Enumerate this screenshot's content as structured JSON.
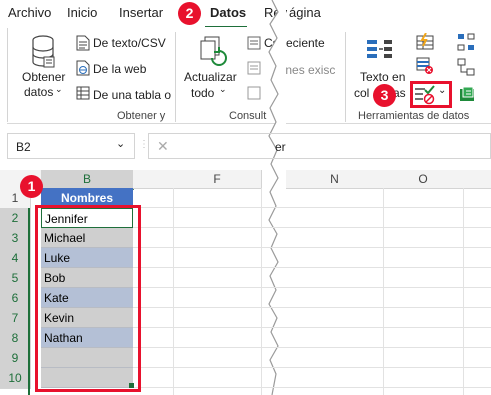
{
  "menu": {
    "file": "Archivo",
    "home": "Inicio",
    "insert": "Insertar",
    "data": "Datos",
    "review": "Rev",
    "page": "ágina"
  },
  "ribbon": {
    "get_data_line1": "Obtener",
    "get_data_line2": "datos",
    "from_text_csv": "De texto/CSV",
    "from_web": "De la web",
    "from_table": "De una tabla o",
    "get_transform_group": "Obtener y",
    "refresh_all_line1": "Actualizar",
    "refresh_all_line2": "todo",
    "recent_sources": "Cs reciente",
    "existing_connections": "iones exisc",
    "queries_group": "Consult",
    "text_to_columns_line1": "Texto en",
    "text_to_columns_line2": "col",
    "text_to_columns_line2b": "as",
    "data_tools_group": "Herramientas de datos"
  },
  "formula_bar": {
    "name_box": "B2",
    "formula_fragment": "er",
    "cancel_symbol": "✕"
  },
  "sheet": {
    "columns": [
      "B",
      "F",
      "N",
      "O"
    ],
    "rows": [
      "1",
      "2",
      "3",
      "4",
      "5",
      "6",
      "7",
      "8",
      "9",
      "10"
    ],
    "header_cell": "Nombres",
    "names": [
      "Jennifer",
      "Michael",
      "Luke",
      "Bob",
      "Kate",
      "Kevin",
      "Nathan"
    ]
  },
  "badges": {
    "one": "1",
    "two": "2",
    "three": "3"
  },
  "colors": {
    "header_fill": "#4472c4",
    "band_light": "#d9e1f2",
    "band_dark": "#b4c0d6",
    "highlight": "#e8112d",
    "excel_green": "#1e6f3a"
  }
}
